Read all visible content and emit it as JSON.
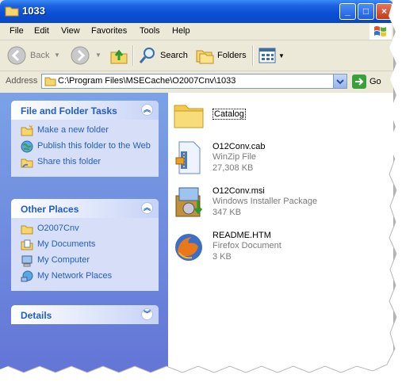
{
  "window": {
    "title": "1033"
  },
  "title_buttons": {
    "minimize": "_",
    "maximize": "□",
    "close": "×"
  },
  "menu": [
    "File",
    "Edit",
    "View",
    "Favorites",
    "Tools",
    "Help"
  ],
  "toolbar": {
    "back_label": "Back",
    "search_label": "Search",
    "folders_label": "Folders"
  },
  "address": {
    "label": "Address",
    "path": "C:\\Program Files\\MSECache\\O2007Cnv\\1033",
    "go_label": "Go"
  },
  "panels": {
    "file_tasks": {
      "title": "File and Folder Tasks",
      "items": [
        {
          "label": "Make a new folder",
          "icon": "new-folder-icon"
        },
        {
          "label": "Publish this folder to the Web",
          "icon": "publish-web-icon"
        },
        {
          "label": "Share this folder",
          "icon": "share-folder-icon"
        }
      ]
    },
    "other_places": {
      "title": "Other Places",
      "items": [
        {
          "label": "O2007Cnv",
          "icon": "folder-icon"
        },
        {
          "label": "My Documents",
          "icon": "my-documents-icon"
        },
        {
          "label": "My Computer",
          "icon": "my-computer-icon"
        },
        {
          "label": "My Network Places",
          "icon": "network-places-icon"
        }
      ]
    },
    "details": {
      "title": "Details"
    }
  },
  "files": [
    {
      "name": "Catalog",
      "type": "",
      "size": "",
      "icon": "folder-icon"
    },
    {
      "name": "O12Conv.cab",
      "type": "WinZip File",
      "size": "27,308 KB",
      "icon": "winzip-file-icon"
    },
    {
      "name": "O12Conv.msi",
      "type": "Windows Installer Package",
      "size": "347 KB",
      "icon": "installer-package-icon"
    },
    {
      "name": "README.HTM",
      "type": "Firefox Document",
      "size": "3 KB",
      "icon": "firefox-document-icon"
    }
  ],
  "colors": {
    "titlebar": "#0a4fd4",
    "task_link": "#215dc6",
    "left_pane_top": "#7ba2e7",
    "left_pane_bottom": "#6375d6"
  }
}
